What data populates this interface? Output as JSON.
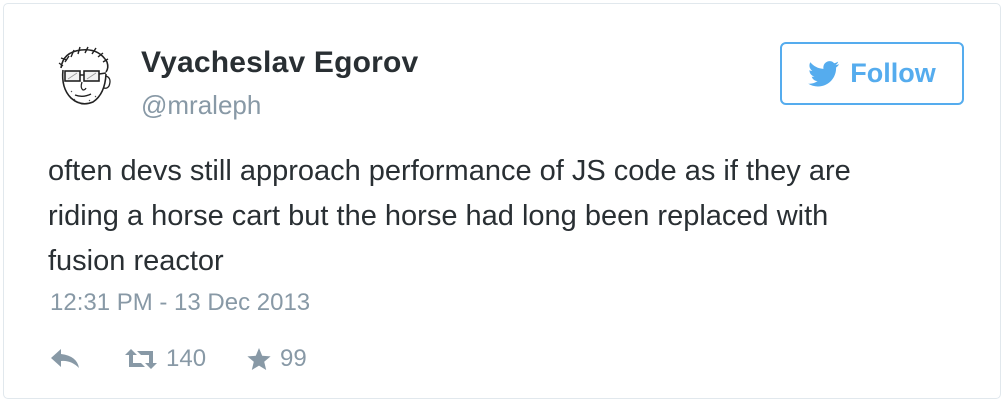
{
  "user": {
    "name": "Vyacheslav Egorov",
    "handle": "@mraleph",
    "avatar_icon": "sketched-face-avatar"
  },
  "follow_button": {
    "label": "Follow",
    "icon": "twitter-bird-icon",
    "color": "#55acee"
  },
  "tweet": {
    "text_lines": [
      "often devs still approach performance of JS code as if they are",
      "riding a horse cart but the horse had long been replaced with",
      "fusion reactor"
    ],
    "timestamp": "12:31 PM - 13 Dec 2013"
  },
  "actions": {
    "reply_icon": "reply-arrow-icon",
    "retweet_icon": "retweet-icon",
    "retweet_count": "140",
    "favorite_icon": "star-icon",
    "favorite_count": "99",
    "icon_color": "#8899a6"
  }
}
